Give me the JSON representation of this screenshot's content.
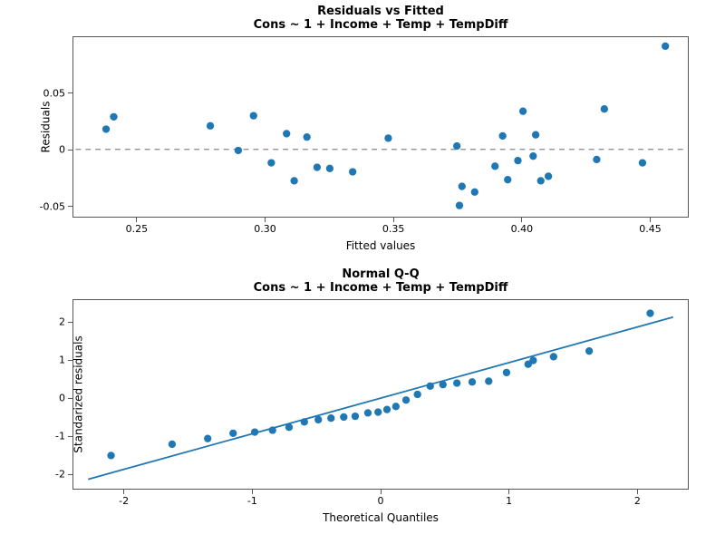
{
  "chart_data": [
    {
      "type": "scatter",
      "title": "Residuals vs Fitted",
      "subtitle": "Cons ~ 1 + Income + Temp + TempDiff",
      "xlabel": "Fitted values",
      "ylabel": "Residuals",
      "xlim": [
        0.225,
        0.465
      ],
      "ylim": [
        -0.06,
        0.1
      ],
      "x_ticks": [
        0.25,
        0.3,
        0.35,
        0.4,
        0.45
      ],
      "y_ticks": [
        -0.05,
        0.0,
        0.05
      ],
      "reference_line_y": 0.0,
      "points": [
        {
          "x": 0.237,
          "y": 0.018
        },
        {
          "x": 0.24,
          "y": 0.029
        },
        {
          "x": 0.278,
          "y": 0.021
        },
        {
          "x": 0.289,
          "y": -0.001
        },
        {
          "x": 0.295,
          "y": 0.03
        },
        {
          "x": 0.302,
          "y": -0.012
        },
        {
          "x": 0.308,
          "y": 0.014
        },
        {
          "x": 0.311,
          "y": -0.028
        },
        {
          "x": 0.316,
          "y": 0.011
        },
        {
          "x": 0.32,
          "y": -0.016
        },
        {
          "x": 0.325,
          "y": -0.017
        },
        {
          "x": 0.334,
          "y": -0.02
        },
        {
          "x": 0.348,
          "y": 0.01
        },
        {
          "x": 0.375,
          "y": 0.003
        },
        {
          "x": 0.376,
          "y": -0.05
        },
        {
          "x": 0.377,
          "y": -0.033
        },
        {
          "x": 0.382,
          "y": -0.038
        },
        {
          "x": 0.39,
          "y": -0.015
        },
        {
          "x": 0.393,
          "y": 0.012
        },
        {
          "x": 0.395,
          "y": -0.027
        },
        {
          "x": 0.399,
          "y": -0.01
        },
        {
          "x": 0.401,
          "y": 0.034
        },
        {
          "x": 0.406,
          "y": 0.013
        },
        {
          "x": 0.405,
          "y": -0.006
        },
        {
          "x": 0.408,
          "y": -0.028
        },
        {
          "x": 0.411,
          "y": -0.024
        },
        {
          "x": 0.43,
          "y": -0.009
        },
        {
          "x": 0.433,
          "y": 0.036
        },
        {
          "x": 0.448,
          "y": -0.012
        },
        {
          "x": 0.457,
          "y": 0.092
        }
      ],
      "colors": {
        "point": "#1f77b4",
        "refline": "#888"
      }
    },
    {
      "type": "scatter",
      "title": "Normal Q-Q",
      "subtitle": "Cons ~ 1 + Income + Temp + TempDiff",
      "xlabel": "Theoretical Quantiles",
      "ylabel": "Standarized residuals",
      "xlim": [
        -2.4,
        2.4
      ],
      "ylim": [
        -2.4,
        2.6
      ],
      "x_ticks": [
        -2,
        -1,
        0,
        1,
        2
      ],
      "y_ticks": [
        -2,
        -1,
        0,
        1,
        2
      ],
      "qq_line": {
        "x0": -2.3,
        "y0": -2.15,
        "x1": 2.3,
        "y1": 2.15
      },
      "points": [
        {
          "x": -2.12,
          "y": -1.52
        },
        {
          "x": -1.64,
          "y": -1.22
        },
        {
          "x": -1.36,
          "y": -1.07
        },
        {
          "x": -1.16,
          "y": -0.93
        },
        {
          "x": -0.99,
          "y": -0.9
        },
        {
          "x": -0.85,
          "y": -0.85
        },
        {
          "x": -0.72,
          "y": -0.77
        },
        {
          "x": -0.6,
          "y": -0.63
        },
        {
          "x": -0.49,
          "y": -0.57
        },
        {
          "x": -0.39,
          "y": -0.53
        },
        {
          "x": -0.29,
          "y": -0.5
        },
        {
          "x": -0.2,
          "y": -0.48
        },
        {
          "x": -0.1,
          "y": -0.39
        },
        {
          "x": -0.02,
          "y": -0.37
        },
        {
          "x": 0.05,
          "y": -0.3
        },
        {
          "x": 0.12,
          "y": -0.22
        },
        {
          "x": 0.2,
          "y": -0.05
        },
        {
          "x": 0.29,
          "y": 0.1
        },
        {
          "x": 0.39,
          "y": 0.32
        },
        {
          "x": 0.49,
          "y": 0.36
        },
        {
          "x": 0.6,
          "y": 0.4
        },
        {
          "x": 0.72,
          "y": 0.43
        },
        {
          "x": 0.85,
          "y": 0.45
        },
        {
          "x": 0.99,
          "y": 0.68
        },
        {
          "x": 1.16,
          "y": 0.9
        },
        {
          "x": 1.2,
          "y": 1.0
        },
        {
          "x": 1.36,
          "y": 1.1
        },
        {
          "x": 1.64,
          "y": 1.25
        },
        {
          "x": 2.12,
          "y": 2.25
        }
      ],
      "colors": {
        "point": "#1f77b4",
        "line": "#1f77b4"
      }
    }
  ]
}
